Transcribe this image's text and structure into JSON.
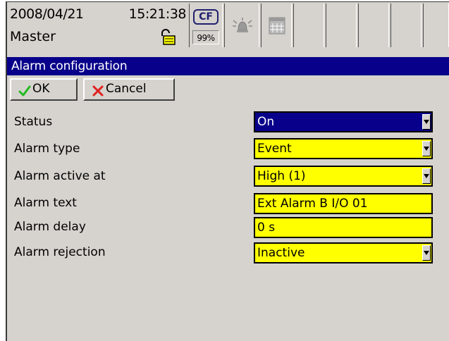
{
  "statusbar": {
    "date": "2008/04/21",
    "time": "15:21:38",
    "user": "Master",
    "cf_label": "CF",
    "cf_percent": "99%",
    "icons": [
      "lock-icon",
      "cf-card-icon",
      "alarm-bell-icon",
      "calendar-icon"
    ]
  },
  "dialog": {
    "title": "Alarm configuration",
    "ok_label": "OK",
    "cancel_label": "Cancel"
  },
  "rows": [
    {
      "label": "Status",
      "value": "On",
      "kind": "select"
    },
    {
      "label": "Alarm type",
      "value": "Event",
      "kind": "select"
    },
    {
      "label": "Alarm active at",
      "value": "High (1)",
      "kind": "select"
    },
    {
      "label": "Alarm text",
      "value": "Ext Alarm B I/O 01",
      "kind": "text"
    },
    {
      "label": "Alarm delay",
      "value": "0 s",
      "kind": "text"
    },
    {
      "label": "Alarm rejection",
      "value": "Inactive",
      "kind": "select"
    }
  ],
  "colors": {
    "title_bar": "#08008a",
    "field_bg": "#ffff00",
    "panel_bg": "#d6d3ce",
    "ok_check": "#22bb22",
    "cancel_x": "#e02020"
  }
}
